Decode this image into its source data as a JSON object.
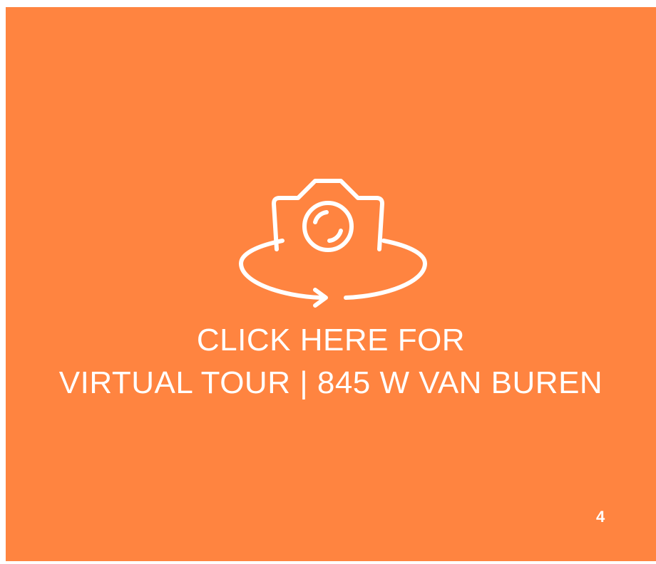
{
  "link": {
    "line1": "CLICK HERE FOR",
    "line2": "VIRTUAL TOUR | 845 W VAN BUREN"
  },
  "icon": "camera-360-icon",
  "page_number": "4",
  "colors": {
    "background": "#ff8440",
    "foreground": "#ffffff"
  }
}
